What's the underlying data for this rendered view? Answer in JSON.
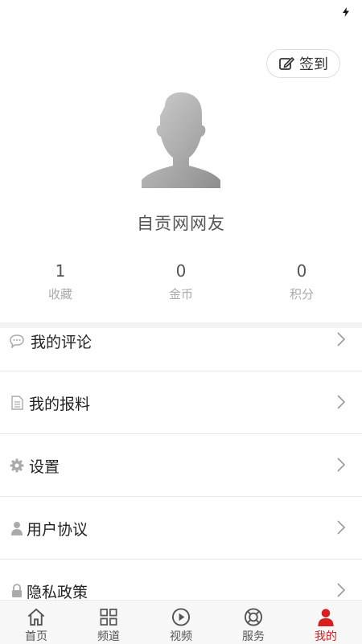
{
  "header": {
    "checkin_label": "签到"
  },
  "profile": {
    "username": "自贡网网友"
  },
  "stats": [
    {
      "value": "1",
      "label": "收藏"
    },
    {
      "value": "0",
      "label": "金币"
    },
    {
      "value": "0",
      "label": "积分"
    }
  ],
  "menu": [
    {
      "label": "我的评论",
      "icon": "comment-icon"
    },
    {
      "label": "我的报料",
      "icon": "document-icon"
    },
    {
      "label": "设置",
      "icon": "gear-icon"
    },
    {
      "label": "用户协议",
      "icon": "user-icon"
    },
    {
      "label": "隐私政策",
      "icon": "lock-icon"
    }
  ],
  "tabs": [
    {
      "label": "首页",
      "icon": "home-icon"
    },
    {
      "label": "频道",
      "icon": "grid-icon"
    },
    {
      "label": "视频",
      "icon": "play-icon"
    },
    {
      "label": "服务",
      "icon": "lifebuoy-icon"
    },
    {
      "label": "我的",
      "icon": "person-icon",
      "active": true
    }
  ],
  "colors": {
    "accent": "#d81e1e",
    "text": "#333333",
    "muted": "#aaaaaa"
  }
}
